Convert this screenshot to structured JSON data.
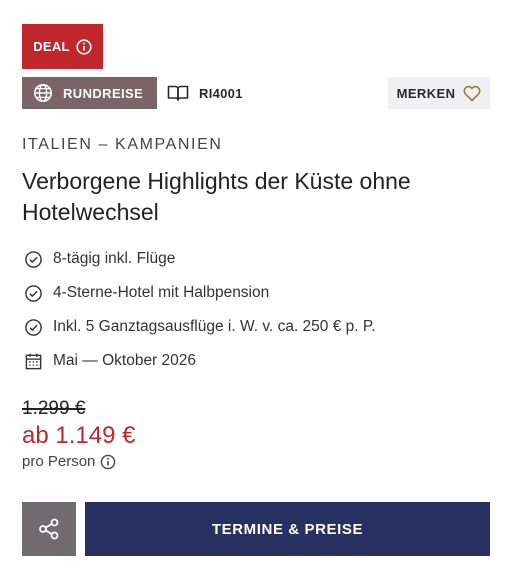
{
  "badge": {
    "label": "DEAL",
    "icon": "info-icon",
    "color": "#c0272d"
  },
  "tour": {
    "type_label": "RUNDREISE",
    "type_icon": "globe-icon",
    "code": "RI4001",
    "code_icon": "book-icon"
  },
  "save": {
    "label": "MERKEN",
    "icon": "heart-icon"
  },
  "region": "ITALIEN – KAMPANIEN",
  "title": "Verborgene Highlights der Küste ohne Hotelwechsel",
  "features": [
    {
      "text": "8-tägig inkl. Flüge",
      "icon": "check-circle-icon"
    },
    {
      "text": "4-Sterne-Hotel mit Halbpension",
      "icon": "check-circle-icon"
    },
    {
      "text": "Inkl. 5 Ganztagsausflüge i. W. v. ca. 250 € p. P.",
      "icon": "check-circle-icon"
    },
    {
      "text": "Mai — Oktober 2026",
      "icon": "calendar-icon"
    }
  ],
  "pricing": {
    "old_price": "1.299 €",
    "price": "ab 1.149 €",
    "per_person": "pro Person",
    "accent": "#c0272d"
  },
  "actions": {
    "share_icon": "share-icon",
    "cta_label": "TERMINE & PREISE",
    "cta_color": "#273060"
  }
}
